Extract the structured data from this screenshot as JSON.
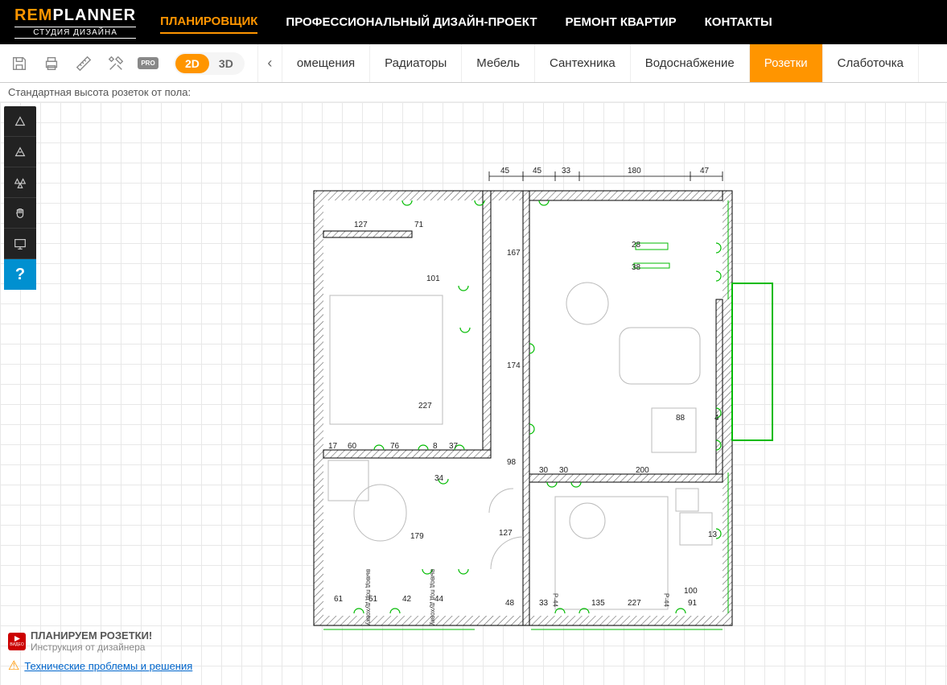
{
  "logo": {
    "rem": "REM",
    "planner": "PLANNER",
    "sub": "СТУДИЯ ДИЗАЙНА"
  },
  "nav": {
    "items": [
      "ПЛАНИРОВЩИК",
      "ПРОФЕССИОНАЛЬНЫЙ ДИЗАЙН-ПРОЕКТ",
      "РЕМОНТ КВАРТИР",
      "КОНТАКТЫ"
    ]
  },
  "toolbar": {
    "pro": "PRO",
    "v2d": "2D",
    "v3d": "3D",
    "arrow": "‹",
    "cats": [
      "омещения",
      "Радиаторы",
      "Мебель",
      "Сантехника",
      "Водоснабжение",
      "Розетки",
      "Слаботочка"
    ]
  },
  "status": "Стандартная высота розеток от пола:",
  "sidetool_help": "?",
  "dims": {
    "d45a": "45",
    "d45b": "45",
    "d33": "33",
    "d180": "180",
    "d47": "47",
    "d127": "127",
    "d71": "71",
    "d167": "167",
    "d28": "28",
    "d38": "38",
    "d101": "101",
    "d174": "174",
    "d227": "227",
    "d88": "88",
    "d4": "4",
    "d17": "17",
    "d60": "60",
    "d76": "76",
    "d8": "8",
    "d37": "37",
    "d34": "34",
    "d98": "98",
    "d30a": "30",
    "d30b": "30",
    "d200": "200",
    "d179": "179",
    "d127b": "127",
    "d61": "61",
    "d51": "51",
    "d42": "42",
    "d44": "44",
    "d48": "48",
    "d33b": "33",
    "d135": "135",
    "d227b": "227",
    "d100": "100",
    "d91": "91",
    "d13": "13",
    "r44a": "P-44",
    "r44b": "P-44"
  },
  "labels": {
    "duh1": "вывод под духовку",
    "duh2": "вывод под духовку"
  },
  "footer": {
    "yt_label": "ВИДЕО",
    "title": "ПЛАНИРУЕМ РОЗЕТКИ!",
    "sub": "Инструкция от дизайнера",
    "tech": "Технические проблемы и решения",
    "warn": "⚠"
  }
}
